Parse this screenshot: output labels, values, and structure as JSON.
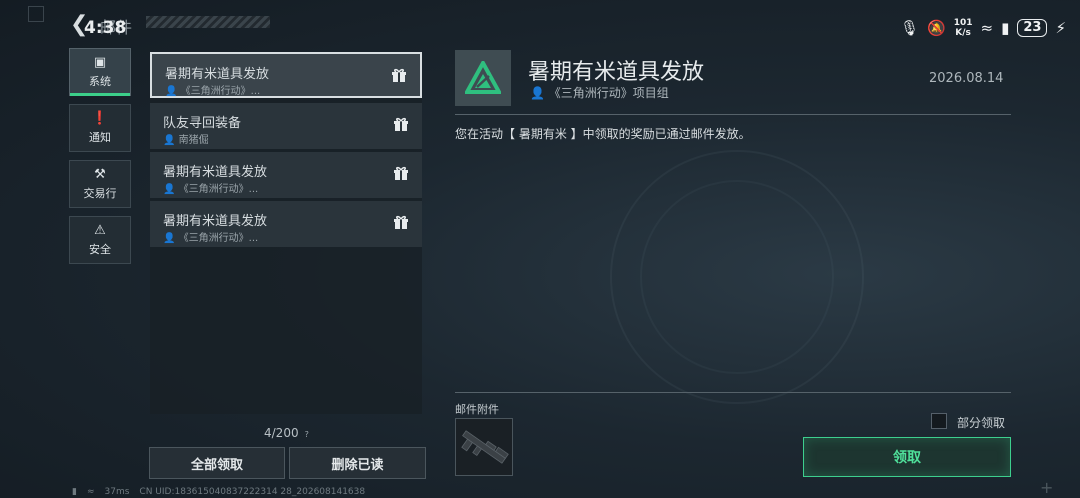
{
  "status_bar": {
    "time": "4:38",
    "net_speed_value": "101",
    "net_speed_unit": "K/s",
    "battery": "23"
  },
  "header": {
    "title": "邮件"
  },
  "categories": [
    {
      "label": "系统",
      "icon": "monitor-icon"
    },
    {
      "label": "通知",
      "icon": "alert-icon"
    },
    {
      "label": "交易行",
      "icon": "gavel-icon"
    },
    {
      "label": "安全",
      "icon": "warning-icon"
    }
  ],
  "mails": [
    {
      "title": "暑期有米道具发放",
      "sender": "《三角洲行动》..."
    },
    {
      "title": "队友寻回装备",
      "sender": "南猪倔"
    },
    {
      "title": "暑期有米道具发放",
      "sender": "《三角洲行动》..."
    },
    {
      "title": "暑期有米道具发放",
      "sender": "《三角洲行动》..."
    }
  ],
  "mail_count": "4/200",
  "mail_count_help": "?",
  "buttons": {
    "claim_all": "全部领取",
    "delete_read": "删除已读"
  },
  "detail": {
    "title": "暑期有米道具发放",
    "sender": "《三角洲行动》项目组",
    "date": "2026.08.14",
    "body": "您在活动【 暑期有米 】中领取的奖励已通过邮件发放。",
    "attachments_label": "邮件附件",
    "partial_claim_label": "部分领取",
    "claim_button": "领取"
  },
  "footer": {
    "ping": "37ms",
    "uid": "CN UID:183615040837222314 28_202608141638"
  },
  "colors": {
    "accent": "#3ccf8a",
    "selected_border": "#d9dfe2",
    "logo_green": "#2fbf7f"
  }
}
